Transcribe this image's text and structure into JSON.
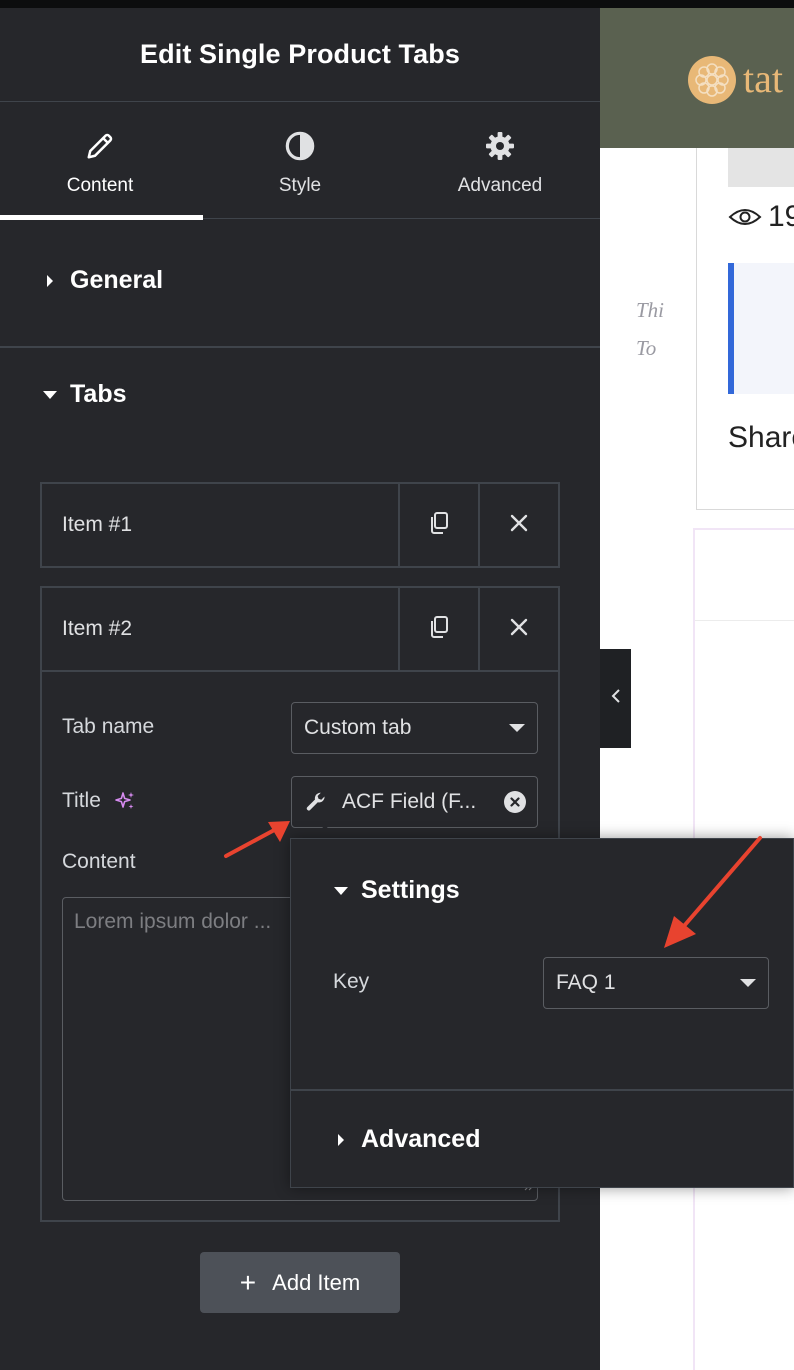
{
  "panel": {
    "title": "Edit Single Product Tabs",
    "tabs": [
      {
        "label": "Content",
        "icon": "pencil-icon",
        "active": true
      },
      {
        "label": "Style",
        "icon": "contrast-icon",
        "active": false
      },
      {
        "label": "Advanced",
        "icon": "gear-icon",
        "active": false
      }
    ],
    "sections": {
      "general": {
        "label": "General",
        "expanded": false
      },
      "tabs": {
        "label": "Tabs",
        "expanded": true
      }
    },
    "items": [
      {
        "title": "Item #1",
        "expanded": false
      },
      {
        "title": "Item #2",
        "expanded": true,
        "tab_name_label": "Tab name",
        "tab_name_value": "Custom tab",
        "title_label": "Title",
        "title_dynamic_tag": "ACF Field (F...",
        "content_label": "Content",
        "content_placeholder": "Lorem ipsum dolor ..."
      }
    ],
    "add_item_label": "Add Item"
  },
  "popover": {
    "settings_label": "Settings",
    "key_label": "Key",
    "key_value": "FAQ 1",
    "advanced_label": "Advanced"
  },
  "preview": {
    "logo_text": "tat",
    "views_text": "19",
    "quote_lines": [
      "Thi",
      "To"
    ],
    "share_text": "Share"
  },
  "colors": {
    "panel_bg": "#26272b",
    "border": "#3f444b",
    "accent_magic": "#d68bf0",
    "annotation_arrow": "#e8432f",
    "logo": "#e8b877"
  }
}
